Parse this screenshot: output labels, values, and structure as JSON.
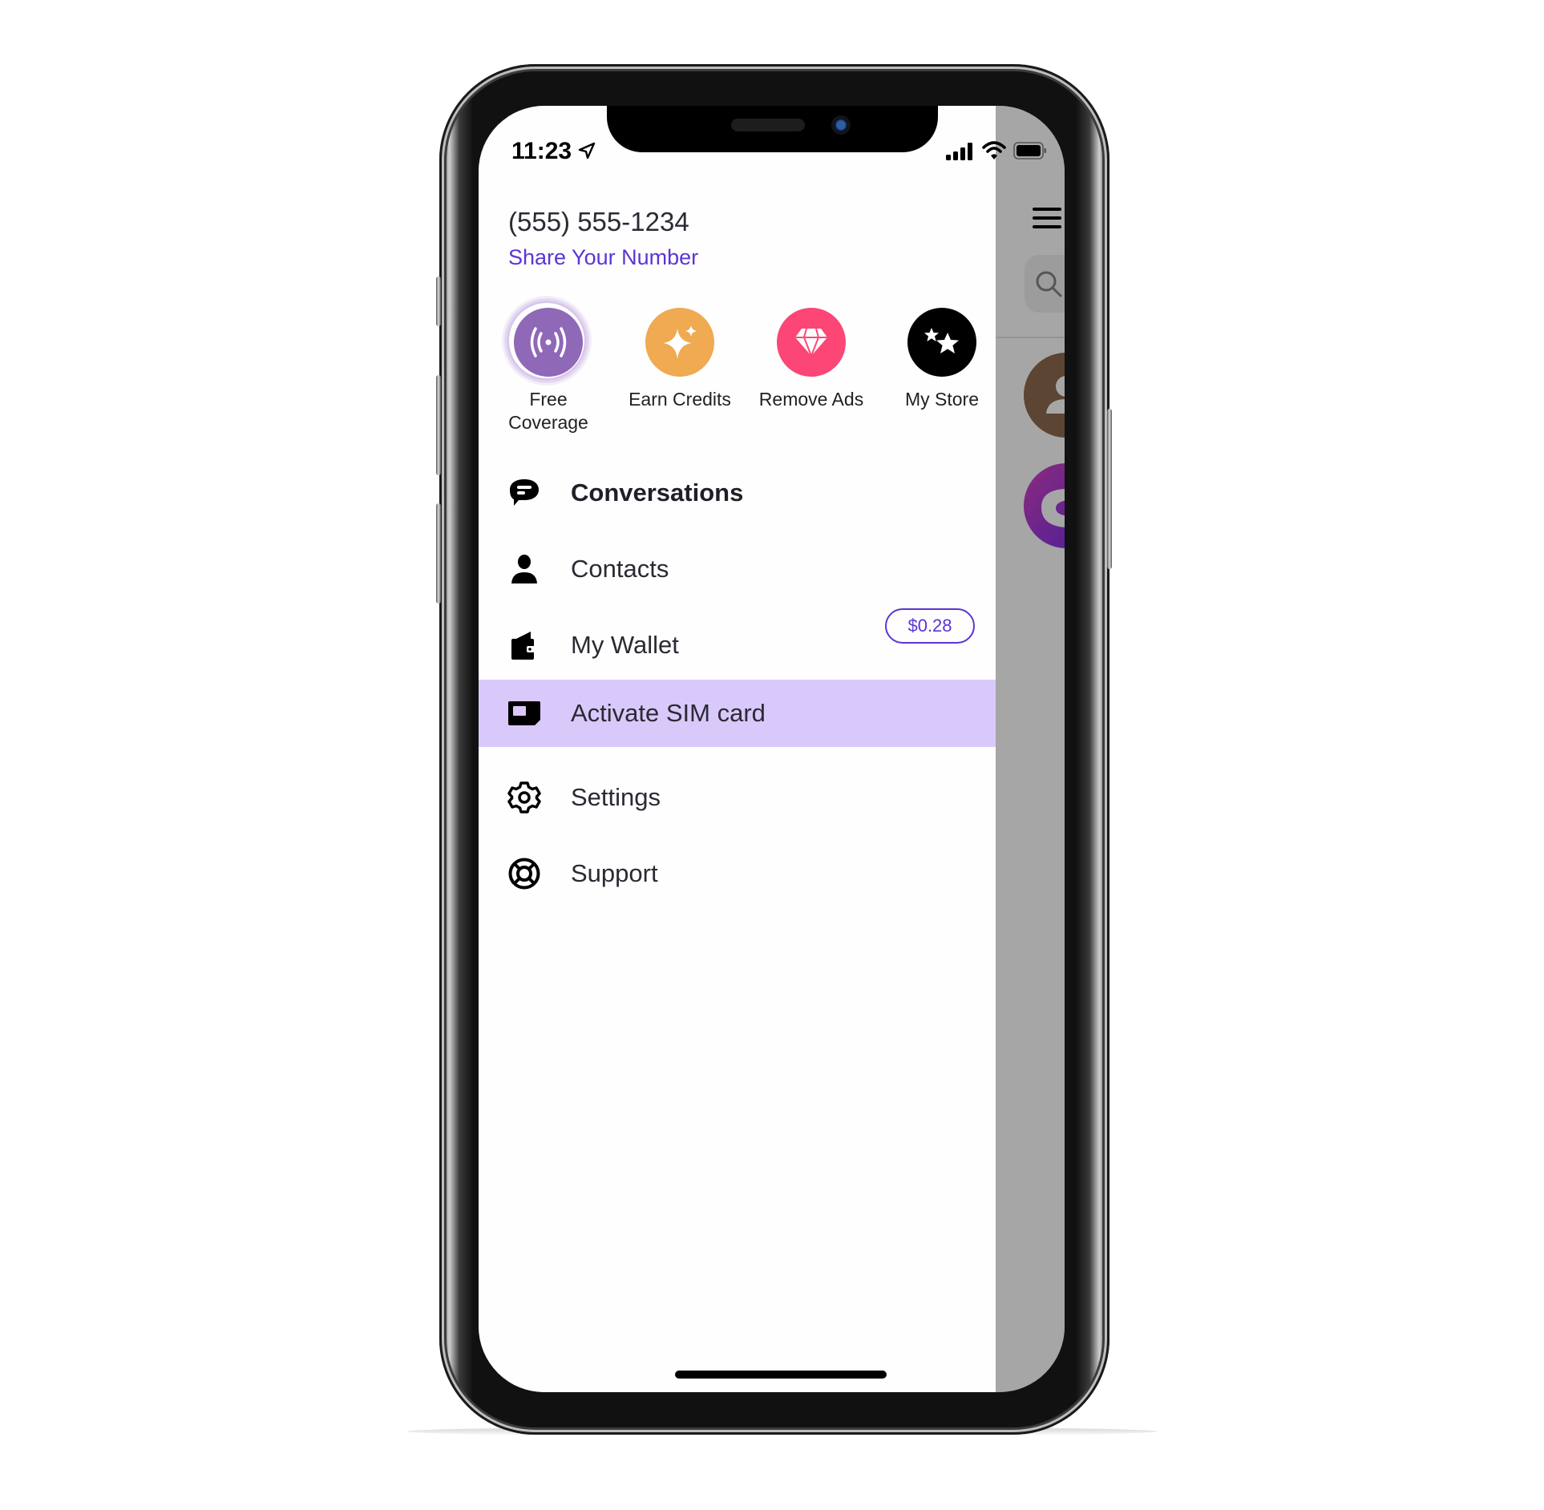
{
  "status_bar": {
    "time": "11:23",
    "location_icon": "location-arrow-icon",
    "signal_icon": "cellular-signal-icon",
    "wifi_icon": "wifi-icon",
    "battery_icon": "battery-icon"
  },
  "account": {
    "phone_number": "(555) 555-1234",
    "share_link": "Share Your Number"
  },
  "quick_actions": [
    {
      "label": "Free\nCoverage",
      "line1": "Free",
      "line2": "Coverage",
      "icon": "broadcast-icon",
      "color": "#8f68b8"
    },
    {
      "label": "Earn Credits",
      "icon": "sparkle-icon",
      "color": "#efaa52"
    },
    {
      "label": "Remove Ads",
      "icon": "diamond-icon",
      "color": "#fb4676"
    },
    {
      "label": "My Store",
      "icon": "stars-icon",
      "color": "#000000"
    }
  ],
  "menu": [
    {
      "label": "Conversations",
      "icon": "chat-bubble-icon",
      "bold": true
    },
    {
      "label": "Contacts",
      "icon": "person-icon"
    },
    {
      "label": "My Wallet",
      "icon": "wallet-icon",
      "badge": "$0.28"
    },
    {
      "label": "Activate SIM card",
      "icon": "sim-card-icon",
      "selected": true
    },
    {
      "label": "Settings",
      "icon": "gear-icon"
    },
    {
      "label": "Support",
      "icon": "lifebuoy-icon"
    }
  ],
  "colors": {
    "accent": "#5b35d5",
    "selected_row": "#d9c9fb",
    "overlay": "#a6a6a6"
  }
}
